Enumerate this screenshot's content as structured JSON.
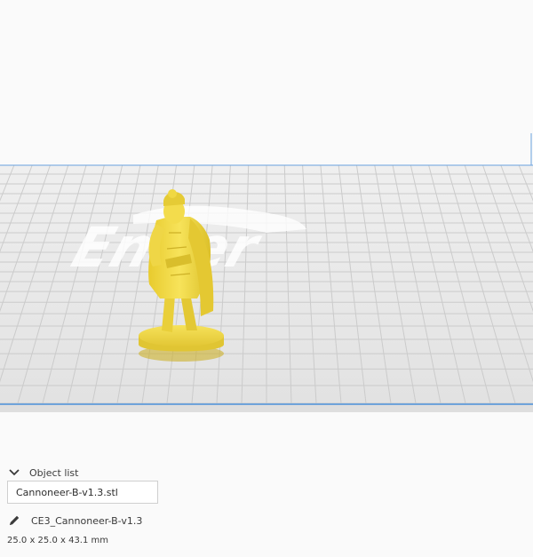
{
  "object_panel": {
    "header_label": "Object list",
    "collapse_icon": "chevron-down-icon",
    "file_name": "Cannoneer-B-v1.3.stl",
    "edit_icon": "pencil-icon",
    "object_name": "CE3_Cannoneer-B-v1.3",
    "dimensions": "25.0 x 25.0 x 43.1 mm"
  },
  "build_plate": {
    "logo_text": "Ender",
    "grid_color": "#c9c9c9",
    "plate_color": "#e9e9e9",
    "edge_color": "#4a8fd9",
    "model_color": "#f2d94a"
  }
}
